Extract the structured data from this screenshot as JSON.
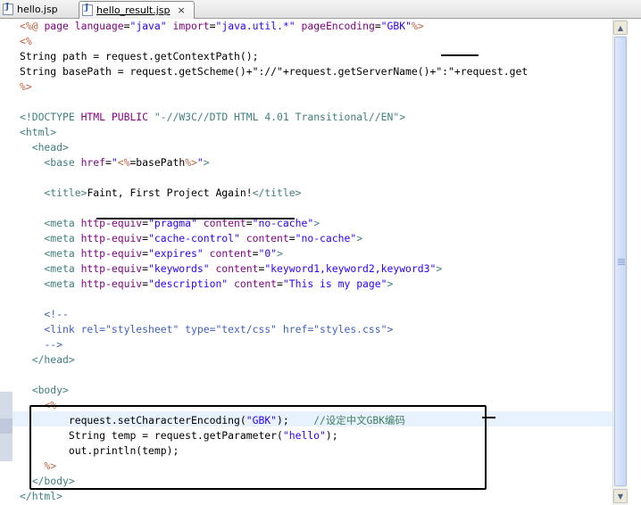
{
  "tabs": [
    {
      "label": "hello.jsp",
      "active": false
    },
    {
      "label": "hello_result.jsp",
      "active": true
    }
  ],
  "close_glyph": "×",
  "code": {
    "l1": {
      "a": "<%@ ",
      "b": "page",
      "c": " ",
      "d": "language",
      "e": "=",
      "f": "\"java\"",
      "g": " ",
      "h": "import",
      "i": "=",
      "j": "\"java.util.*\"",
      "k": " ",
      "l": "pageEncoding",
      "m": "=",
      "n": "\"GBK\"",
      "o": "%>"
    },
    "l2": "<%",
    "l3": "String path = request.getContextPath();",
    "l4": "String basePath = request.getScheme()+\"://\"+request.getServerName()+\":\"+request.get",
    "l5": "%>",
    "l6": "",
    "l7": {
      "a": "<!DOCTYPE ",
      "b": "HTML",
      "c": " ",
      "d": "PUBLIC",
      "e": " \"-//W3C//DTD HTML 4.01 Transitional//EN\">"
    },
    "l8": "<html>",
    "l9": "  <head>",
    "l10": {
      "a": "    <base ",
      "b": "href",
      "c": "=",
      "d": "\"",
      "e": "<%",
      "f": "=basePath",
      "g": "%>",
      "h": "\"",
      "i": ">"
    },
    "l11": "",
    "l12": {
      "a": "    <title>",
      "b": "Faint, First Project Again!",
      "c": "</title>"
    },
    "l13": "",
    "l14": {
      "a": "    <meta ",
      "b": "http-equiv",
      "c": "=",
      "d": "\"pragma\"",
      "e": " ",
      "f": "content",
      "g": "=",
      "h": "\"no-cache\"",
      "i": ">"
    },
    "l15": {
      "a": "    <meta ",
      "b": "http-equiv",
      "c": "=",
      "d": "\"cache-control\"",
      "e": " ",
      "f": "content",
      "g": "=",
      "h": "\"no-cache\"",
      "i": ">"
    },
    "l16": {
      "a": "    <meta ",
      "b": "http-equiv",
      "c": "=",
      "d": "\"expires\"",
      "e": " ",
      "f": "content",
      "g": "=",
      "h": "\"0\"",
      "i": ">"
    },
    "l17": {
      "a": "    <meta ",
      "b": "http-equiv",
      "c": "=",
      "d": "\"keywords\"",
      "e": " ",
      "f": "content",
      "g": "=",
      "h": "\"keyword1,keyword2,keyword3\"",
      "i": ">"
    },
    "l18": {
      "a": "    <meta ",
      "b": "http-equiv",
      "c": "=",
      "d": "\"description\"",
      "e": " ",
      "f": "content",
      "g": "=",
      "h": "\"This is my page\"",
      "i": ">"
    },
    "l19": "",
    "l20": "    <!--",
    "l21": "    <link rel=\"stylesheet\" type=\"text/css\" href=\"styles.css\">",
    "l22": "    -->",
    "l23": "  </head>",
    "l24": "",
    "l25": "  <body>",
    "l26": "    <%",
    "l27": {
      "a": "        request.setCharacterEncoding(",
      "b": "\"GBK\"",
      "c": ");    ",
      "d": "//设定中文GBK编码"
    },
    "l28": {
      "a": "        String temp = request.getParameter(",
      "b": "\"hello\"",
      "c": ");"
    },
    "l29": "        out.println(temp);",
    "l30": "    %>",
    "l31": "  </body>",
    "l32": "</html>"
  },
  "colors": {
    "directive": "#bf5f3f",
    "keyword": "#7f007f",
    "tag": "#3f7f7f",
    "string": "#2a00ff",
    "comment": "#3f5fbf",
    "java_comment": "#3f7f5f",
    "current_line": "#e8f2fe"
  }
}
